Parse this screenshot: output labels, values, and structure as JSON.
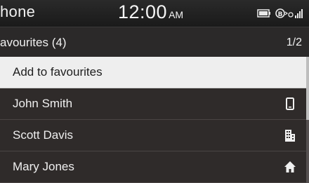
{
  "status_bar": {
    "app_title": "hone",
    "time": "12:00",
    "ampm": "AM",
    "icons": [
      "battery-icon",
      "bluetooth-icon",
      "signal-icon"
    ]
  },
  "header": {
    "title": "avourites (4)",
    "page": "1/2"
  },
  "list": {
    "items": [
      {
        "label": "Add to favourites",
        "icon": "",
        "selected": true
      },
      {
        "label": "John Smith",
        "icon": "mobile-phone-icon",
        "selected": false
      },
      {
        "label": "Scott Davis",
        "icon": "office-building-icon",
        "selected": false
      },
      {
        "label": "Mary Jones",
        "icon": "home-icon",
        "selected": false
      }
    ]
  },
  "colors": {
    "background": "#2f2b2a",
    "highlight": "#eeeeee",
    "text": "#efefef"
  }
}
